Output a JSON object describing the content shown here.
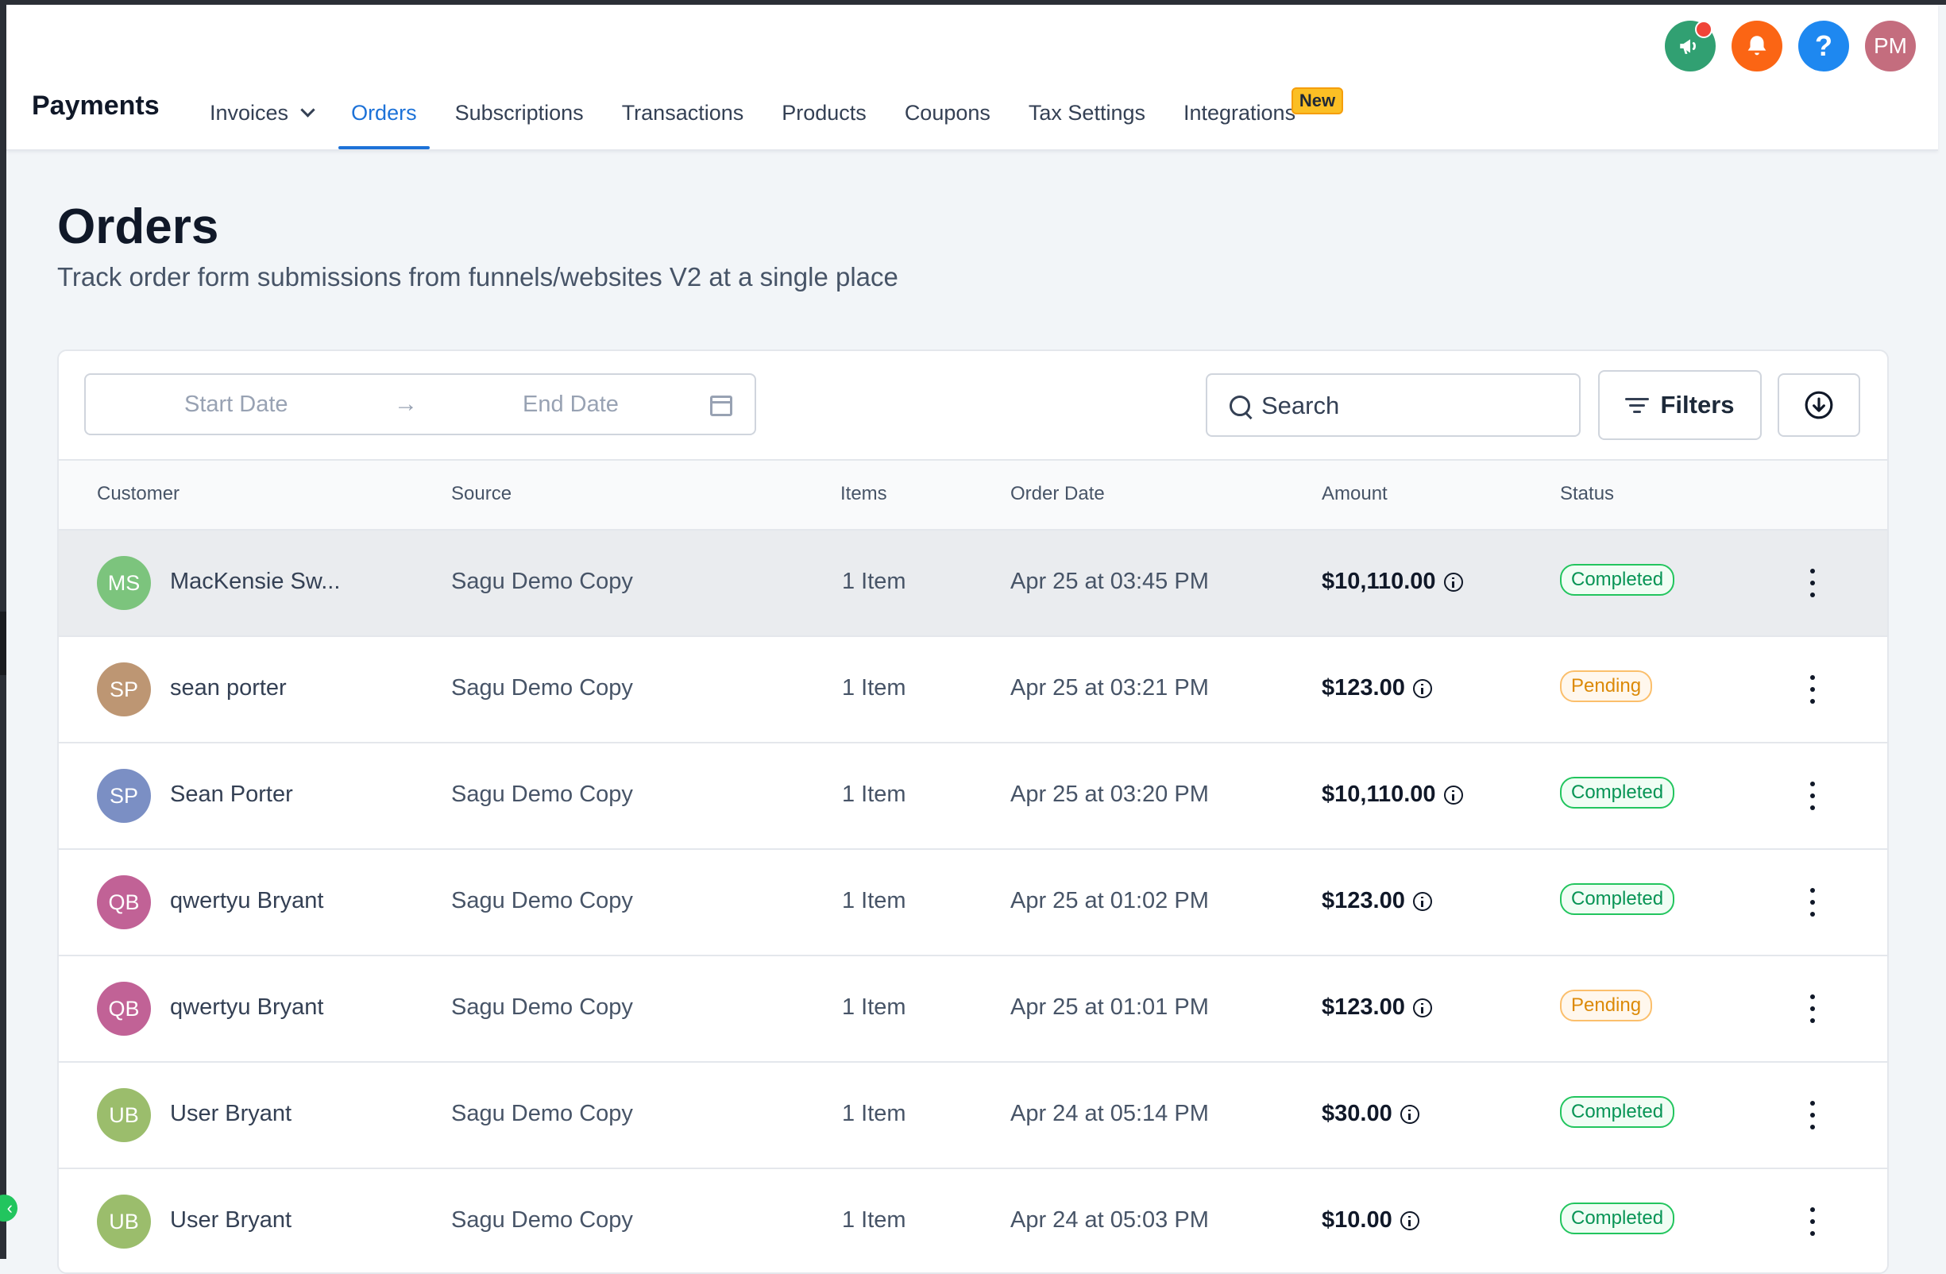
{
  "header": {
    "app_title": "Payments",
    "nav": [
      {
        "label": "Invoices",
        "has_dropdown": true
      },
      {
        "label": "Orders",
        "active": true
      },
      {
        "label": "Subscriptions"
      },
      {
        "label": "Transactions"
      },
      {
        "label": "Products"
      },
      {
        "label": "Coupons"
      },
      {
        "label": "Tax Settings"
      },
      {
        "label": "Integrations",
        "badge": "New"
      }
    ],
    "icons": [
      {
        "name": "megaphone-icon",
        "color": "#31a072",
        "has_notification_dot": true
      },
      {
        "name": "bell-icon",
        "color": "#fb6514"
      },
      {
        "name": "help-icon",
        "label": "?",
        "color": "#1e88f0"
      },
      {
        "name": "user-avatar",
        "label": "PM",
        "color": "#c46d7e"
      }
    ]
  },
  "page": {
    "title": "Orders",
    "subtitle": "Track order form submissions from funnels/websites V2 at a single place"
  },
  "toolbar": {
    "start_date_placeholder": "Start Date",
    "arrow": "→",
    "end_date_placeholder": "End Date",
    "search_placeholder": "Search",
    "filters_label": "Filters"
  },
  "table": {
    "columns": [
      "Customer",
      "Source",
      "Items",
      "Order Date",
      "Amount",
      "Status"
    ],
    "rows": [
      {
        "initials": "MS",
        "avatar_color": "#7cc47d",
        "customer": "MacKensie Sw...",
        "source": "Sagu Demo Copy",
        "items": "1 Item",
        "date": "Apr 25 at 03:45 PM",
        "amount": "$10,110.00",
        "status": "Completed"
      },
      {
        "initials": "SP",
        "avatar_color": "#bd9673",
        "customer": "sean porter",
        "source": "Sagu Demo Copy",
        "items": "1 Item",
        "date": "Apr 25 at 03:21 PM",
        "amount": "$123.00",
        "status": "Pending"
      },
      {
        "initials": "SP",
        "avatar_color": "#7b8fc4",
        "customer": "Sean Porter",
        "source": "Sagu Demo Copy",
        "items": "1 Item",
        "date": "Apr 25 at 03:20 PM",
        "amount": "$10,110.00",
        "status": "Completed"
      },
      {
        "initials": "QB",
        "avatar_color": "#c16296",
        "customer": "qwertyu Bryant",
        "source": "Sagu Demo Copy",
        "items": "1 Item",
        "date": "Apr 25 at 01:02 PM",
        "amount": "$123.00",
        "status": "Completed"
      },
      {
        "initials": "QB",
        "avatar_color": "#c16296",
        "customer": "qwertyu Bryant",
        "source": "Sagu Demo Copy",
        "items": "1 Item",
        "date": "Apr 25 at 01:01 PM",
        "amount": "$123.00",
        "status": "Pending"
      },
      {
        "initials": "UB",
        "avatar_color": "#9bbd6c",
        "customer": "User Bryant",
        "source": "Sagu Demo Copy",
        "items": "1 Item",
        "date": "Apr 24 at 05:14 PM",
        "amount": "$30.00",
        "status": "Completed"
      },
      {
        "initials": "UB",
        "avatar_color": "#9bbd6c",
        "customer": "User Bryant",
        "source": "Sagu Demo Copy",
        "items": "1 Item",
        "date": "Apr 24 at 05:03 PM",
        "amount": "$10.00",
        "status": "Completed"
      }
    ]
  }
}
